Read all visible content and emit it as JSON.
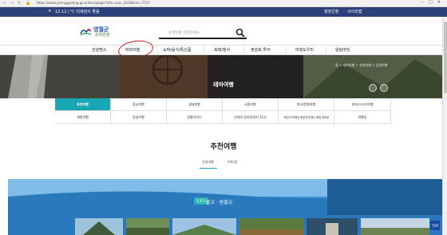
{
  "browser": {
    "url": "https://www.yeonggyeong.go.kr/tour/page/?site=tour_2019&mn=7517"
  },
  "topbar": {
    "weather": "12.12 / ℃ 미세먼지 좋음",
    "links": [
      "행정군청",
      "사이트맵"
    ]
  },
  "header": {
    "logo_main": "영월군",
    "logo_sub": "문화관광",
    "search_placeholder": "검색어를 입력하세요."
  },
  "gnb": [
    "관광명소",
    "테마여행",
    "숙박/음식/특산품",
    "축제/행사",
    "영광로,투어",
    "여행도우미",
    "알림마당"
  ],
  "hero": {
    "title": "테마여행",
    "breadcrumb": "홈 > 테마여행 > 추천여행 > 당일여행"
  },
  "categories": [
    [
      "추천여행",
      "종교여행",
      "생태여행",
      "사찰여행",
      "역사/문화여행",
      "레저/스포츠여행"
    ],
    [
      "체험여행",
      "동굴여행",
      "영월이야기",
      "인제의 탐방관광지 11선",
      "국립나무박물관 화분천선(행)스피랑 탐방로",
      "여행길"
    ]
  ],
  "section": {
    "title": "추천여행",
    "tabs": [
      "당일여행",
      "1박2일"
    ]
  },
  "feature": {
    "badge": "1코스",
    "label": "불교 · 원불교"
  },
  "top_button": "TOP",
  "colors": {
    "accent": "#19a7b5",
    "navy": "#2c4079",
    "circle": "#d21c1c"
  }
}
